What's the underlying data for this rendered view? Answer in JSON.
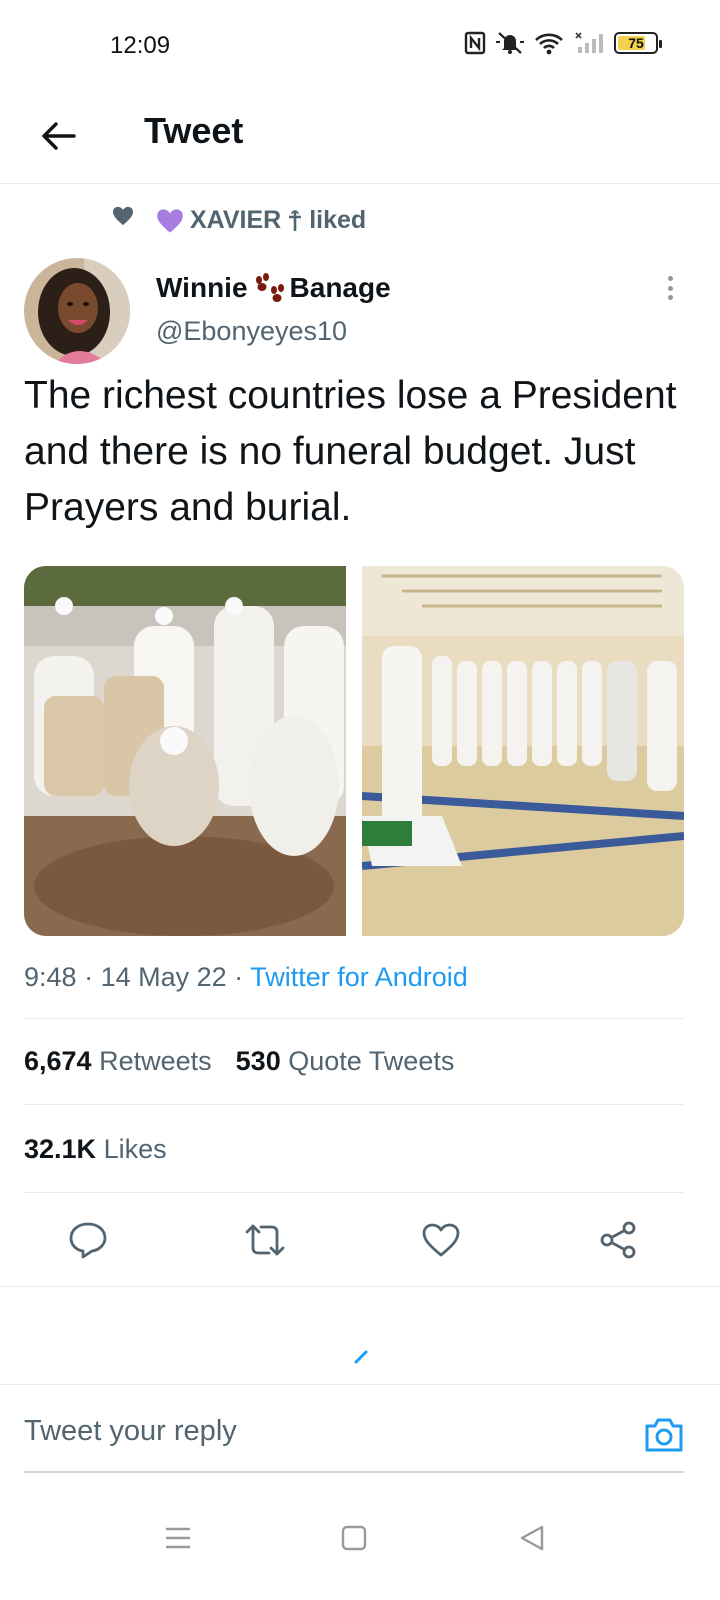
{
  "status_bar": {
    "time": "12:09",
    "battery_percent": "75",
    "battery_level": 0.75,
    "icons": [
      "nfc-icon",
      "mute-icon",
      "wifi-icon",
      "signal-icon",
      "battery-icon"
    ]
  },
  "header": {
    "title": "Tweet",
    "back_icon": "arrow-left-icon"
  },
  "social_context": {
    "user": "XAVIER",
    "action": "liked",
    "icon": "heart-icon",
    "user_emoji_icon": "purple-heart-icon",
    "user_badge_icon": "cross-icon"
  },
  "tweet": {
    "author_name_first": "Winnie",
    "author_name_last": "Banage",
    "author_handle": "@Ebonyeyes10",
    "name_emoji_icon": "paw-prints-icon",
    "text": "The richest countries lose a President and there is no funeral budget. Just Prayers and burial.",
    "time": "9:48",
    "date": "14 May 22",
    "source": "Twitter for Android",
    "images": [
      "burial-photo",
      "prayer-hall-photo"
    ]
  },
  "stats": {
    "retweets_count": "6,674",
    "retweets_label": "Retweets",
    "quote_count": "530",
    "quote_label": "Quote Tweets",
    "likes_count": "32.1K",
    "likes_label": "Likes"
  },
  "actions": [
    "reply-icon",
    "retweet-icon",
    "like-icon",
    "share-icon"
  ],
  "reply": {
    "placeholder": "Tweet your reply",
    "camera_icon": "camera-icon"
  },
  "nav": [
    "menu-icon",
    "home-square-icon",
    "back-triangle-icon"
  ],
  "colors": {
    "accent": "#1d9bf0",
    "secondary_text": "#536471",
    "purple_heart": "#a77ee0",
    "battery": "#f2d24a"
  }
}
